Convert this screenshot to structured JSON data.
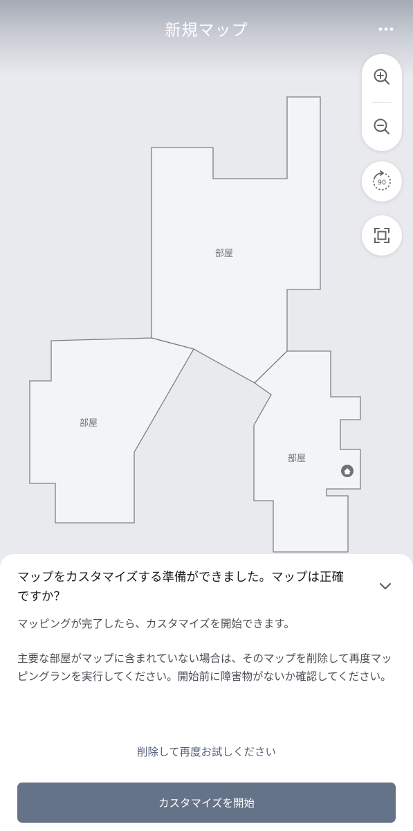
{
  "header": {
    "title": "新規マップ",
    "more_icon": "more-horizontal-icon"
  },
  "map": {
    "rooms": [
      {
        "label": "部屋"
      },
      {
        "label": "部屋"
      },
      {
        "label": "部屋"
      }
    ],
    "dock_icon": "home-icon",
    "colors": {
      "background": "#e9eaee",
      "room_fill": "#f3f4f6",
      "room_outline": "#7d8087"
    }
  },
  "controls": {
    "zoom_in_icon": "zoom-in-icon",
    "zoom_out_icon": "zoom-out-icon",
    "rotate_icon": "rotate-90-icon",
    "rotate_label": "90",
    "fit_icon": "fit-screen-icon"
  },
  "sheet": {
    "title": "マップをカスタマイズする準備ができました。マップは正確ですか？",
    "collapse_icon": "chevron-down-icon",
    "paragraph1": "マッピングが完了したら、カスタマイズを開始できます。",
    "paragraph2": "主要な部屋がマップに含まれていない場合は、そのマップを削除して再度マッピングランを実行してください。開始前に障害物がないか確認してください。",
    "retry_link": "削除して再度お試しください",
    "primary_button": "カスタマイズを開始",
    "colors": {
      "primary_button": "#657388",
      "link": "#54627c"
    }
  }
}
